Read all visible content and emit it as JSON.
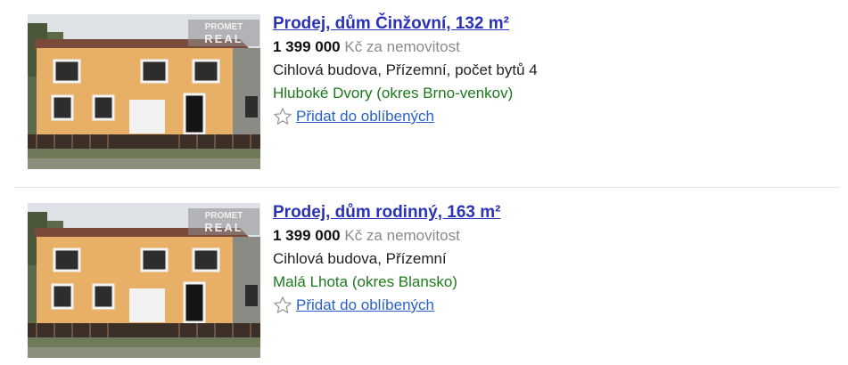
{
  "listings": [
    {
      "title": "Prodej, dům Činžovní, 132 m²",
      "price": "1 399 000",
      "price_unit": "Kč za nemovitost",
      "description": "Cihlová budova, Přízemní, počet bytů 4",
      "location": "Hluboké Dvory (okres Brno-venkov)",
      "favorite_label": "Přidat do oblíbených",
      "watermark": [
        "PROMET",
        "REAL"
      ]
    },
    {
      "title": "Prodej, dům rodinný, 163 m²",
      "price": "1 399 000",
      "price_unit": "Kč za nemovitost",
      "description": "Cihlová budova, Přízemní",
      "location": "Malá Lhota (okres Blansko)",
      "favorite_label": "Přidat do oblíbených",
      "watermark": [
        "PROMET",
        "REAL"
      ]
    }
  ],
  "colors": {
    "title_link": "#2a33b8",
    "location": "#1c7a1c",
    "favorite_link": "#2a62c9",
    "price_unit": "#8a8a8a"
  }
}
